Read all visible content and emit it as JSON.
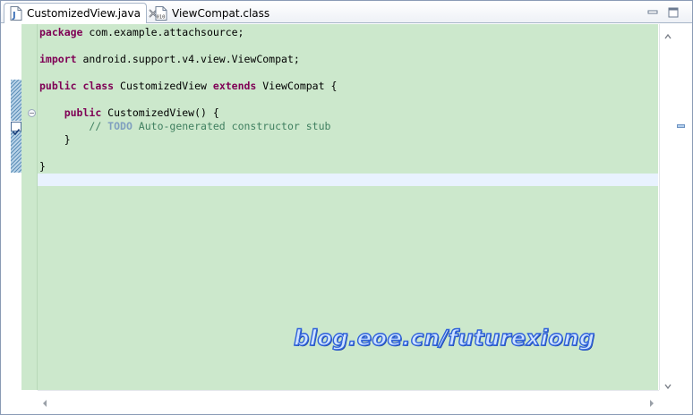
{
  "tabs": {
    "active": {
      "label": "CustomizedView.java",
      "icon": "java-file-icon"
    },
    "inactive": {
      "label": "ViewCompat.class",
      "icon": "class-file-icon"
    }
  },
  "window_controls": {
    "minimize_icon": "minimize-icon",
    "maximize_icon": "maximize-icon"
  },
  "code": {
    "line1": {
      "kw": "package",
      "rest": " com.example.attachsource;"
    },
    "line2": {
      "kw": "import",
      "rest": " android.support.v4.view.ViewCompat;"
    },
    "line3": {
      "kw1": "public",
      "kw2": "class",
      "mid": " CustomizedView ",
      "kw3": "extends",
      "rest": " ViewCompat {"
    },
    "line4": {
      "indent": "    ",
      "kw": "public",
      "rest": " CustomizedView() {"
    },
    "line5": {
      "indent": "        ",
      "comment_prefix": "// ",
      "todo": "TODO",
      "comment_rest": " Auto-generated constructor stub"
    },
    "line6": {
      "text": "    }"
    },
    "line7": {
      "text": "}"
    }
  },
  "watermark": "blog.eoe.cn/futurexiong",
  "colors": {
    "editor_background": "#cce8cc",
    "current_line": "#e8f2fe",
    "keyword": "#7f0055",
    "comment": "#3f7f5f",
    "todo": "#7f9fbf",
    "watermark_fill": "#cfe3ff",
    "watermark_stroke": "#2f62d9"
  }
}
